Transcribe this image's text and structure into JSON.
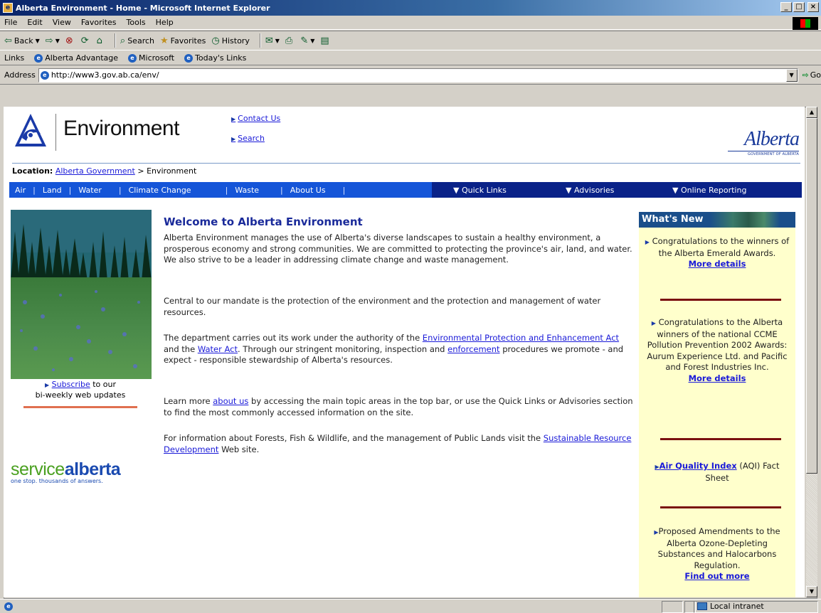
{
  "window": {
    "title": "Alberta Environment - Home - Microsoft Internet Explorer",
    "controls": [
      "_",
      "□",
      "×"
    ]
  },
  "menu": [
    "File",
    "Edit",
    "View",
    "Favorites",
    "Tools",
    "Help"
  ],
  "toolbar": {
    "back": "Back",
    "search": "Search",
    "favorites": "Favorites",
    "history": "History"
  },
  "links_bar": {
    "label": "Links",
    "items": [
      "Alberta Advantage",
      "Microsoft",
      "Today's Links"
    ]
  },
  "address": {
    "label": "Address",
    "url": "http://www3.gov.ab.ca/env/",
    "go": "Go"
  },
  "page": {
    "site_title": "Environment",
    "top_links": [
      "Contact Us",
      "Search"
    ],
    "alberta_logo": {
      "word": "Alberta",
      "sub": "GOVERNMENT OF ALBERTA"
    },
    "location": {
      "label": "Location:",
      "link": "Alberta Government",
      "separator": ">",
      "current": "Environment"
    },
    "nav": [
      "Air",
      "Land",
      "Water",
      "Climate Change",
      "Waste",
      "About Us"
    ],
    "nav_dropdowns": [
      "Quick Links",
      "Advisories",
      "Online Reporting"
    ],
    "subscribe": {
      "link": "Subscribe",
      "rest1": " to our",
      "rest2": "bi-weekly web updates"
    },
    "service_logo": {
      "word1": "service",
      "word2": "alberta",
      "tagline": "one stop. thousands of answers."
    },
    "main_title": "Welcome to Alberta Environment",
    "p1": "Alberta Environment manages the use of Alberta's diverse landscapes to sustain a healthy environment, a prosperous economy and strong communities. We are committed to protecting the province's air, land, and water. We also strive to be a leader in addressing climate change and waste management.",
    "p2": "Central to our mandate is the protection of the environment and the protection and management of water resources.",
    "p3": {
      "a": "The department carries out its work under the authority of the ",
      "link1": "Environmental Protection and Enhancement Act ",
      "b": "and the ",
      "link2": "Water Act",
      "c": ". Through our stringent monitoring, inspection and ",
      "link3": "enforcement",
      "d": " procedures we promote - and expect - responsible stewardship of Alberta's resources."
    },
    "p4": {
      "a": "Learn more ",
      "link": "about us",
      "b": " by accessing the main topic areas in the top bar, or use the Quick Links or Advisories section to find the most commonly accessed information on the site."
    },
    "p5": {
      "a": "For information about Forests, Fish & Wildlife, and the management of Public Lands visit the ",
      "link": "Sustainable Resource Development",
      "b": " Web site."
    },
    "whats_new": {
      "header": "What's New",
      "item1": {
        "text": "Congratulations to the winners of the Alberta Emerald Awards.",
        "link": "More details"
      },
      "item2": {
        "text": "Congratulations to the Alberta winners of the national CCME Pollution Prevention 2002 Awards: Aurum Experience Ltd. and Pacific and Forest Industries Inc.",
        "link": "More details"
      },
      "item3": {
        "link": "Air Quality Index",
        "rest": " (AQI) Fact Sheet"
      },
      "item4": {
        "text": "Proposed Amendments to the Alberta Ozone-Depleting Substances and Halocarbons Regulation.",
        "link": "Find out more"
      }
    }
  },
  "status": {
    "zone": "Local intranet"
  }
}
